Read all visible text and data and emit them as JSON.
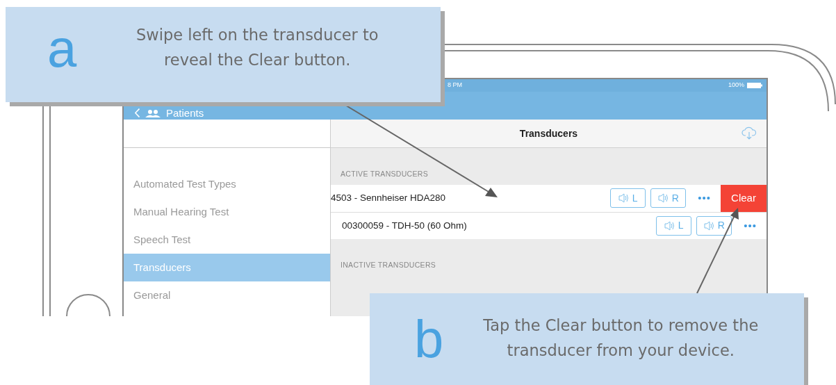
{
  "callouts": [
    {
      "letter": "a",
      "text": "Swipe left on the transducer to reveal the Clear button."
    },
    {
      "letter": "b",
      "text": "Tap the Clear button to remove the transducer from your device."
    }
  ],
  "status_bar": {
    "time": "8 PM",
    "battery": "100%"
  },
  "nav": {
    "back_label": "Patients"
  },
  "sidebar": {
    "items": [
      {
        "label": "Automated Test Types",
        "selected": false
      },
      {
        "label": "Manual Hearing Test",
        "selected": false
      },
      {
        "label": "Speech Test",
        "selected": false
      },
      {
        "label": "Transducers",
        "selected": true
      },
      {
        "label": "General",
        "selected": false
      }
    ]
  },
  "detail": {
    "title": "Transducers",
    "sections": [
      {
        "heading": "ACTIVE TRANSDUCERS",
        "rows": [
          {
            "name": "4503 - Sennheiser HDA280",
            "swiped": true,
            "left_label": "L",
            "right_label": "R",
            "more": "•••",
            "action": "Clear"
          },
          {
            "name": "00300059 - TDH-50 (60 Ohm)",
            "swiped": false,
            "left_label": "L",
            "right_label": "R",
            "more": "•••"
          }
        ]
      },
      {
        "heading": "INACTIVE TRANSDUCERS"
      }
    ]
  }
}
